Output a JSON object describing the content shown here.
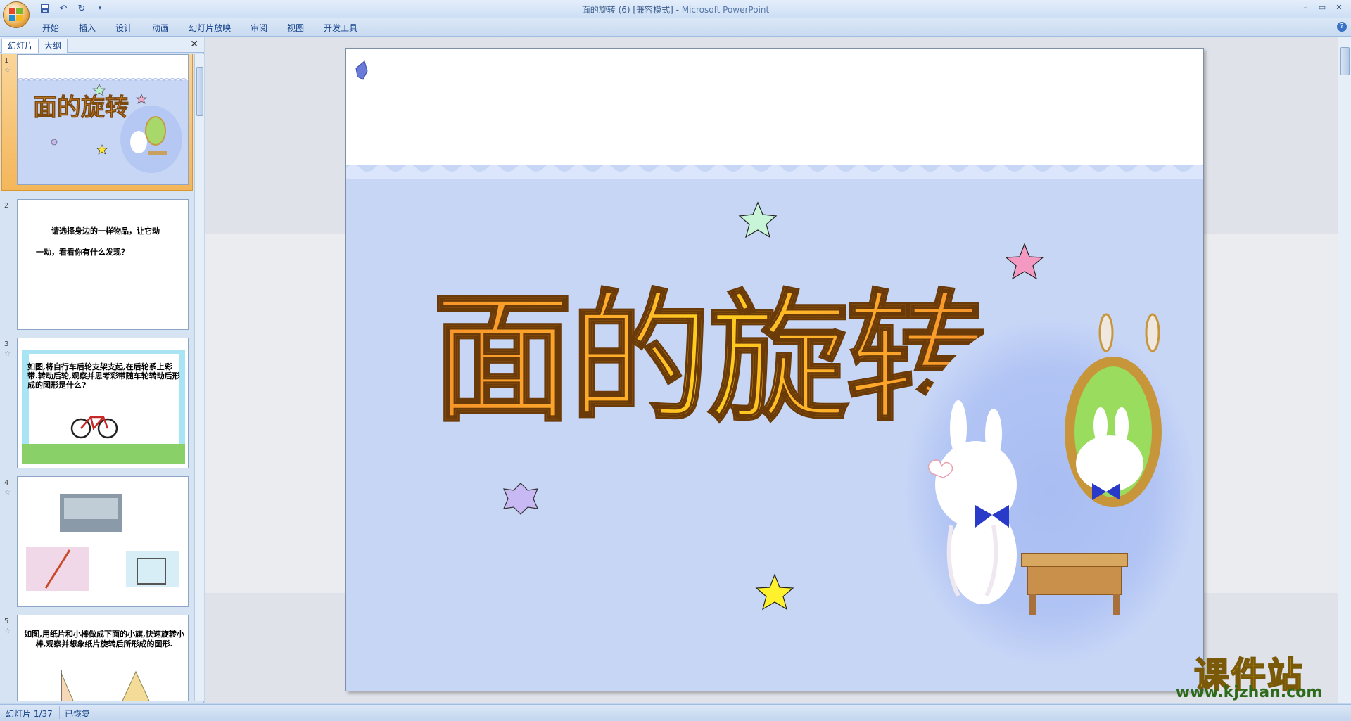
{
  "window": {
    "document_title": "面的旋转 (6) [兼容模式] - ",
    "app_name": "Microsoft PowerPoint",
    "controls": [
      "–",
      "▭",
      "✕"
    ]
  },
  "ribbon": {
    "tabs": [
      "开始",
      "插入",
      "设计",
      "动画",
      "幻灯片放映",
      "审阅",
      "视图",
      "开发工具"
    ],
    "help": "?"
  },
  "pane": {
    "tab_slides": "幻灯片",
    "tab_outline": "大纲",
    "close": "✕"
  },
  "thumbnails": [
    {
      "num": "1",
      "title": "面的旋转"
    },
    {
      "num": "2",
      "line1": "请选择身边的一样物品，让它动",
      "line2": "一动，看看你有什么发现？"
    },
    {
      "num": "3",
      "text": "如图,将自行车后轮支架支起,在后轮系上彩带.转动后轮,观察并思考彩带随车轮转动后形成的图形是什么?"
    },
    {
      "num": "4"
    },
    {
      "num": "5",
      "text": "如图,用纸片和小棒做成下面的小旗,快速旋转小棒,观察并想象纸片旋转后所形成的图形."
    }
  ],
  "slide": {
    "title": "面的旋转"
  },
  "status": {
    "slide_position": "幻灯片 1/37",
    "recovered": "已恢复"
  },
  "watermark": {
    "name": "课件站",
    "url": "www.kjzhan.com"
  },
  "colors": {
    "ribbon_bg": "#c9dbf1",
    "slide_blue": "#c8d6f6",
    "title_orange": "#f6932a",
    "title_yellow": "#ffd21c",
    "selected_thumb": "#f6a646"
  }
}
